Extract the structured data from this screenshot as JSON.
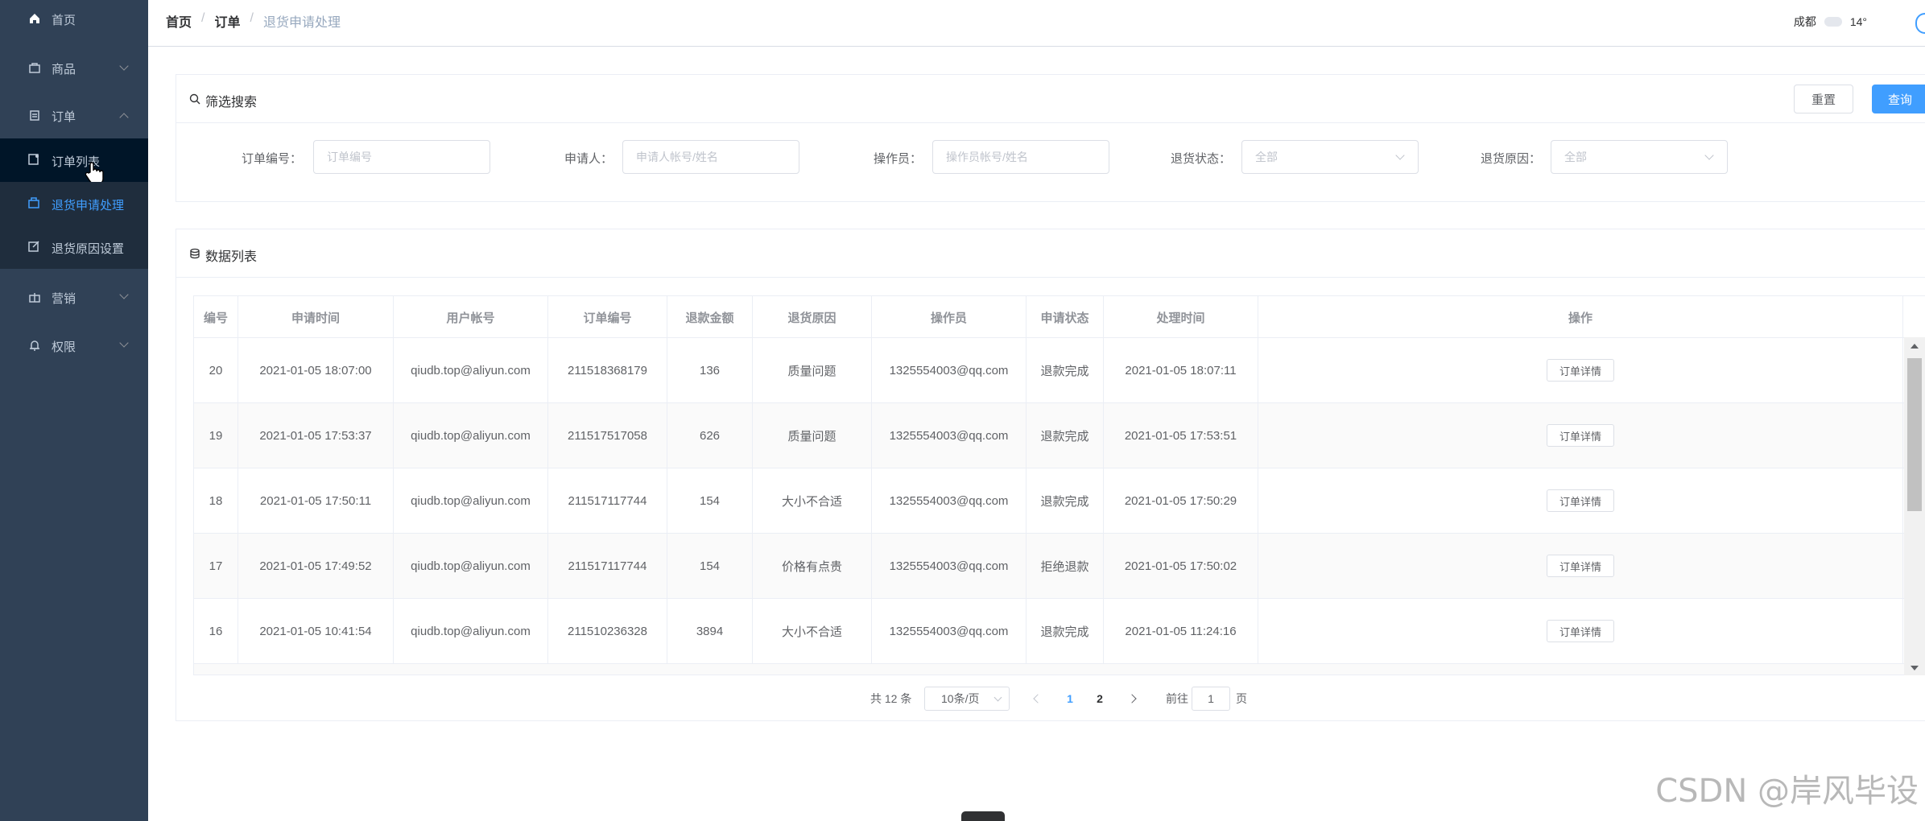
{
  "sidebar": {
    "items": [
      {
        "label": "首页",
        "icon": "home-icon"
      },
      {
        "label": "商品",
        "icon": "bag-icon"
      },
      {
        "label": "订单",
        "icon": "clipboard-icon"
      },
      {
        "label": "营销",
        "icon": "gift-icon"
      },
      {
        "label": "权限",
        "icon": "bell-icon"
      }
    ],
    "order_sub": [
      {
        "label": "订单列表",
        "icon": "order-list-icon"
      },
      {
        "label": "退货申请处理",
        "icon": "return-icon"
      },
      {
        "label": "退货原因设置",
        "icon": "edit-icon"
      }
    ]
  },
  "header": {
    "breadcrumb": [
      "首页",
      "订单",
      "退货申请处理"
    ],
    "breadcrumb_sep": "/",
    "city": "成都",
    "temperature": "14°"
  },
  "filter": {
    "title": "筛选搜索",
    "reset_label": "重置",
    "query_label": "查询",
    "fields": [
      {
        "label": "订单编号：",
        "placeholder": "订单编号"
      },
      {
        "label": "申请人：",
        "placeholder": "申请人帐号/姓名"
      },
      {
        "label": "操作员：",
        "placeholder": "操作员帐号/姓名"
      },
      {
        "label": "退货状态：",
        "value": "全部"
      },
      {
        "label": "退货原因：",
        "value": "全部"
      }
    ]
  },
  "list": {
    "title": "数据列表",
    "columns": [
      "编号",
      "申请时间",
      "用户帐号",
      "订单编号",
      "退款金额",
      "退货原因",
      "操作员",
      "申请状态",
      "处理时间",
      "操作"
    ],
    "detail_label": "订单详情",
    "rows": [
      [
        "20",
        "2021-01-05 18:07:00",
        "qiudb.top@aliyun.com",
        "211518368179",
        "136",
        "质量问题",
        "1325554003@qq.com",
        "退款完成",
        "2021-01-05 18:07:11"
      ],
      [
        "19",
        "2021-01-05 17:53:37",
        "qiudb.top@aliyun.com",
        "211517517058",
        "626",
        "质量问题",
        "1325554003@qq.com",
        "退款完成",
        "2021-01-05 17:53:51"
      ],
      [
        "18",
        "2021-01-05 17:50:11",
        "qiudb.top@aliyun.com",
        "211517117744",
        "154",
        "大小不合适",
        "1325554003@qq.com",
        "退款完成",
        "2021-01-05 17:50:29"
      ],
      [
        "17",
        "2021-01-05 17:49:52",
        "qiudb.top@aliyun.com",
        "211517117744",
        "154",
        "价格有点贵",
        "1325554003@qq.com",
        "拒绝退款",
        "2021-01-05 17:50:02"
      ],
      [
        "16",
        "2021-01-05 10:41:54",
        "qiudb.top@aliyun.com",
        "211510236328",
        "3894",
        "大小不合适",
        "1325554003@qq.com",
        "退款完成",
        "2021-01-05 11:24:16"
      ]
    ]
  },
  "pagination": {
    "total": "共 12 条",
    "page_size": "10条/页",
    "pages": [
      "1",
      "2"
    ],
    "current": "1",
    "goto_prefix": "前往",
    "goto_value": "1",
    "goto_suffix": "页"
  },
  "watermark": "CSDN @岸风毕设",
  "colors": {
    "sidebar": "#304156",
    "accent": "#409eff"
  }
}
